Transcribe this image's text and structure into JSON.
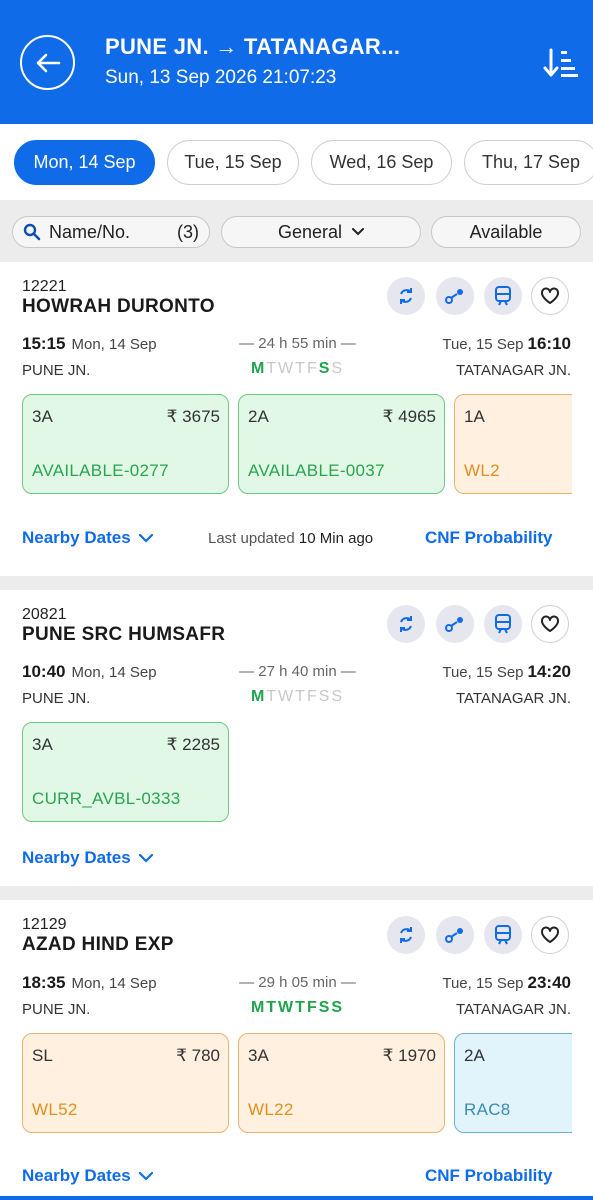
{
  "header": {
    "title": "PUNE JN. → TATANAGAR...",
    "subtitle": "Sun, 13 Sep 2026 21:07:23",
    "back_icon": "arrow-left-icon",
    "sort_icon": "sort-descending-icon"
  },
  "dates": [
    {
      "label": "Mon, 14 Sep",
      "active": true
    },
    {
      "label": "Tue, 15 Sep",
      "active": false
    },
    {
      "label": "Wed, 16 Sep",
      "active": false
    },
    {
      "label": "Thu, 17 Sep",
      "active": false
    }
  ],
  "filters": {
    "search_label": "Name/No.",
    "search_count": "(3)",
    "quota": "General",
    "availability": "Available"
  },
  "trains": [
    {
      "number": "12221",
      "name": "HOWRAH DURONTO",
      "dep_time": "15:15",
      "dep_date": "Mon, 14 Sep",
      "arr_date": "Tue, 15 Sep",
      "arr_time": "16:10",
      "duration": "— 24 h 55 min —",
      "from": "PUNE JN.",
      "to": "TATANAGAR JN.",
      "days": [
        "M",
        "T",
        "W",
        "T",
        "F",
        "S",
        "S"
      ],
      "classes": [
        {
          "cls": "3A",
          "fare": "₹ 3675",
          "status": "AVAILABLE-0277"
        },
        {
          "cls": "2A",
          "fare": "₹ 4965",
          "status": "AVAILABLE-0037"
        },
        {
          "cls": "1A",
          "fare": "",
          "status": "WL2"
        }
      ],
      "nearby": "Nearby Dates",
      "updated_prefix": "Last updated",
      "updated_value": "10 Min ago",
      "cnf": "CNF Probability"
    },
    {
      "number": "20821",
      "name": "PUNE SRC HUMSAFR",
      "dep_time": "10:40",
      "dep_date": "Mon, 14 Sep",
      "arr_date": "Tue, 15 Sep",
      "arr_time": "14:20",
      "duration": "— 27 h 40 min —",
      "from": "PUNE JN.",
      "to": "TATANAGAR JN.",
      "days": [
        "M",
        "T",
        "W",
        "T",
        "F",
        "S",
        "S"
      ],
      "classes": [
        {
          "cls": "3A",
          "fare": "₹ 2285",
          "status": "CURR_AVBL-0333"
        }
      ],
      "nearby": "Nearby Dates"
    },
    {
      "number": "12129",
      "name": "AZAD HIND EXP",
      "dep_time": "18:35",
      "dep_date": "Mon, 14 Sep",
      "arr_date": "Tue, 15 Sep",
      "arr_time": "23:40",
      "duration": "— 29 h 05 min —",
      "from": "PUNE JN.",
      "to": "TATANAGAR JN.",
      "days": [
        "M",
        "T",
        "W",
        "T",
        "F",
        "S",
        "S"
      ],
      "classes": [
        {
          "cls": "SL",
          "fare": "₹ 780",
          "status": "WL52"
        },
        {
          "cls": "3A",
          "fare": "₹ 1970",
          "status": "WL22"
        },
        {
          "cls": "2A",
          "fare": "",
          "status": "RAC8"
        }
      ],
      "nearby": "Nearby Dates",
      "cnf": "CNF Probability"
    }
  ],
  "colors": {
    "brand": "#0f6be8",
    "available": "#2aa44f",
    "waitlist": "#e0901e",
    "rac": "#3a8ab4"
  }
}
